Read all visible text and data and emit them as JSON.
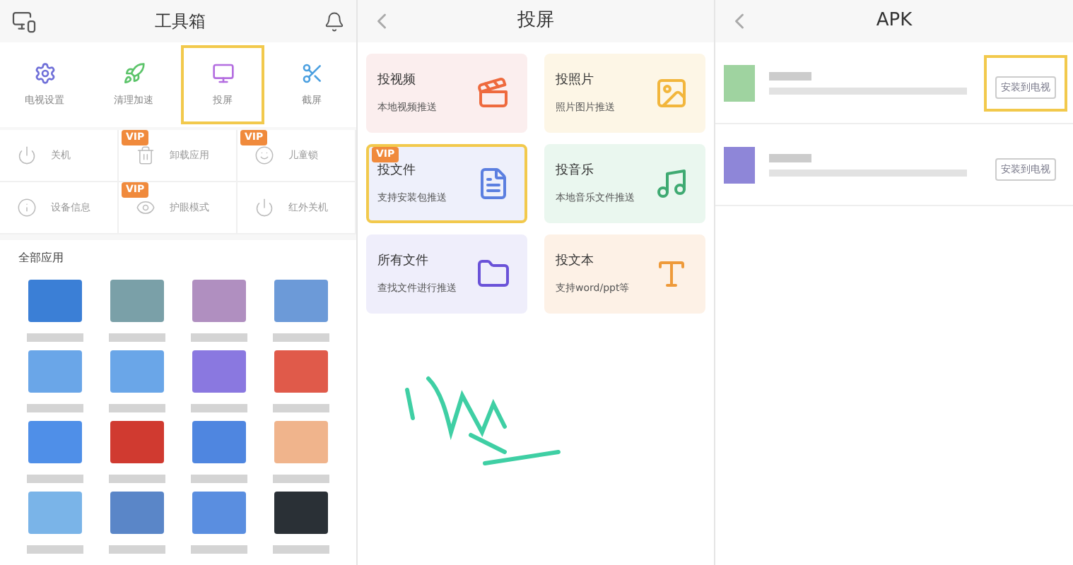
{
  "toolbox": {
    "title": "工具箱",
    "tools": [
      {
        "label": "电视设置",
        "highlighted": false
      },
      {
        "label": "清理加速",
        "highlighted": false
      },
      {
        "label": "投屏",
        "highlighted": true
      },
      {
        "label": "截屏",
        "highlighted": false
      }
    ],
    "actions": [
      {
        "label": "关机"
      },
      {
        "label": "卸载应用",
        "badge": "VIP"
      },
      {
        "label": "儿童锁",
        "badge": "VIP"
      },
      {
        "label": "设备信息"
      },
      {
        "label": "护眼模式",
        "badge": "VIP"
      },
      {
        "label": "红外关机"
      }
    ],
    "section_title": "全部应用",
    "apps": [
      {
        "color": "#3b7fd6"
      },
      {
        "color": "#7aa0a8"
      },
      {
        "color": "#b08fc0"
      },
      {
        "color": "#6c9ad8"
      },
      {
        "color": "#6aa6e8"
      },
      {
        "color": "#6aa6e8"
      },
      {
        "color": "#8a78e0"
      },
      {
        "color": "#e05a4a"
      },
      {
        "color": "#4f8fe8"
      },
      {
        "color": "#d03a30"
      },
      {
        "color": "#4f86e0"
      },
      {
        "color": "#f0b48c"
      },
      {
        "color": "#7ab4e8"
      },
      {
        "color": "#5a86c8"
      },
      {
        "color": "#5a8ee0"
      },
      {
        "color": "#2a3036"
      }
    ]
  },
  "cast": {
    "title": "投屏",
    "cards": [
      {
        "title": "投视频",
        "subtitle": "本地视频推送",
        "highlighted": false
      },
      {
        "title": "投照片",
        "subtitle": "照片图片推送",
        "highlighted": false
      },
      {
        "title": "投文件",
        "subtitle": "支持安装包推送",
        "badge": "VIP",
        "highlighted": true
      },
      {
        "title": "投音乐",
        "subtitle": "本地音乐文件推送",
        "highlighted": false
      },
      {
        "title": "所有文件",
        "subtitle": "查找文件进行推送",
        "highlighted": false
      },
      {
        "title": "投文本",
        "subtitle": "支持word/ppt等",
        "highlighted": false
      }
    ]
  },
  "apk": {
    "title": "APK",
    "items": [
      {
        "button": "安装到电视",
        "highlighted": true,
        "color": "#9fd3a0"
      },
      {
        "button": "安装到电视",
        "highlighted": false,
        "color": "#8e86d8"
      }
    ]
  }
}
